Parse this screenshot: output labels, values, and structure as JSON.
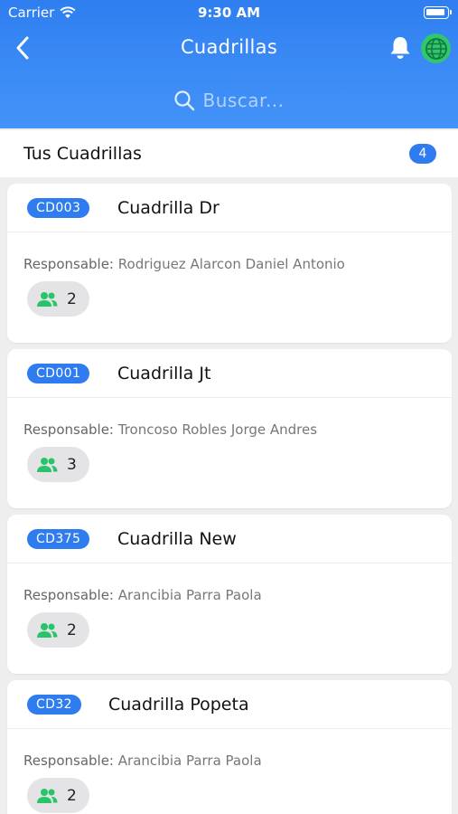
{
  "status": {
    "carrier": "Carrier",
    "time": "9:30 AM"
  },
  "nav": {
    "title": "Cuadrillas"
  },
  "search": {
    "placeholder": "Buscar..."
  },
  "section": {
    "label": "Tus Cuadrillas",
    "count": "4"
  },
  "icons": {
    "back": "chevron-left-icon",
    "bell": "bell-icon",
    "globe": "globe-icon",
    "search": "search-icon",
    "members": "people-icon"
  },
  "colors": {
    "primary": "#2f7cf0",
    "globe": "#2fc66d",
    "members_icon": "#27c46a"
  },
  "cards": [
    {
      "code": "CD003",
      "name": "Cuadrilla Dr",
      "resp_label": "Responsable:",
      "resp_value": "Rodriguez Alarcon Daniel Antonio",
      "members": "2"
    },
    {
      "code": "CD001",
      "name": "Cuadrilla Jt",
      "resp_label": "Responsable:",
      "resp_value": "Troncoso Robles Jorge Andres",
      "members": "3"
    },
    {
      "code": "CD375",
      "name": "Cuadrilla New",
      "resp_label": "Responsable:",
      "resp_value": "Arancibia Parra Paola",
      "members": "2"
    },
    {
      "code": "CD32",
      "name": "Cuadrilla Popeta",
      "resp_label": "Responsable:",
      "resp_value": "Arancibia Parra Paola",
      "members": "2"
    }
  ]
}
